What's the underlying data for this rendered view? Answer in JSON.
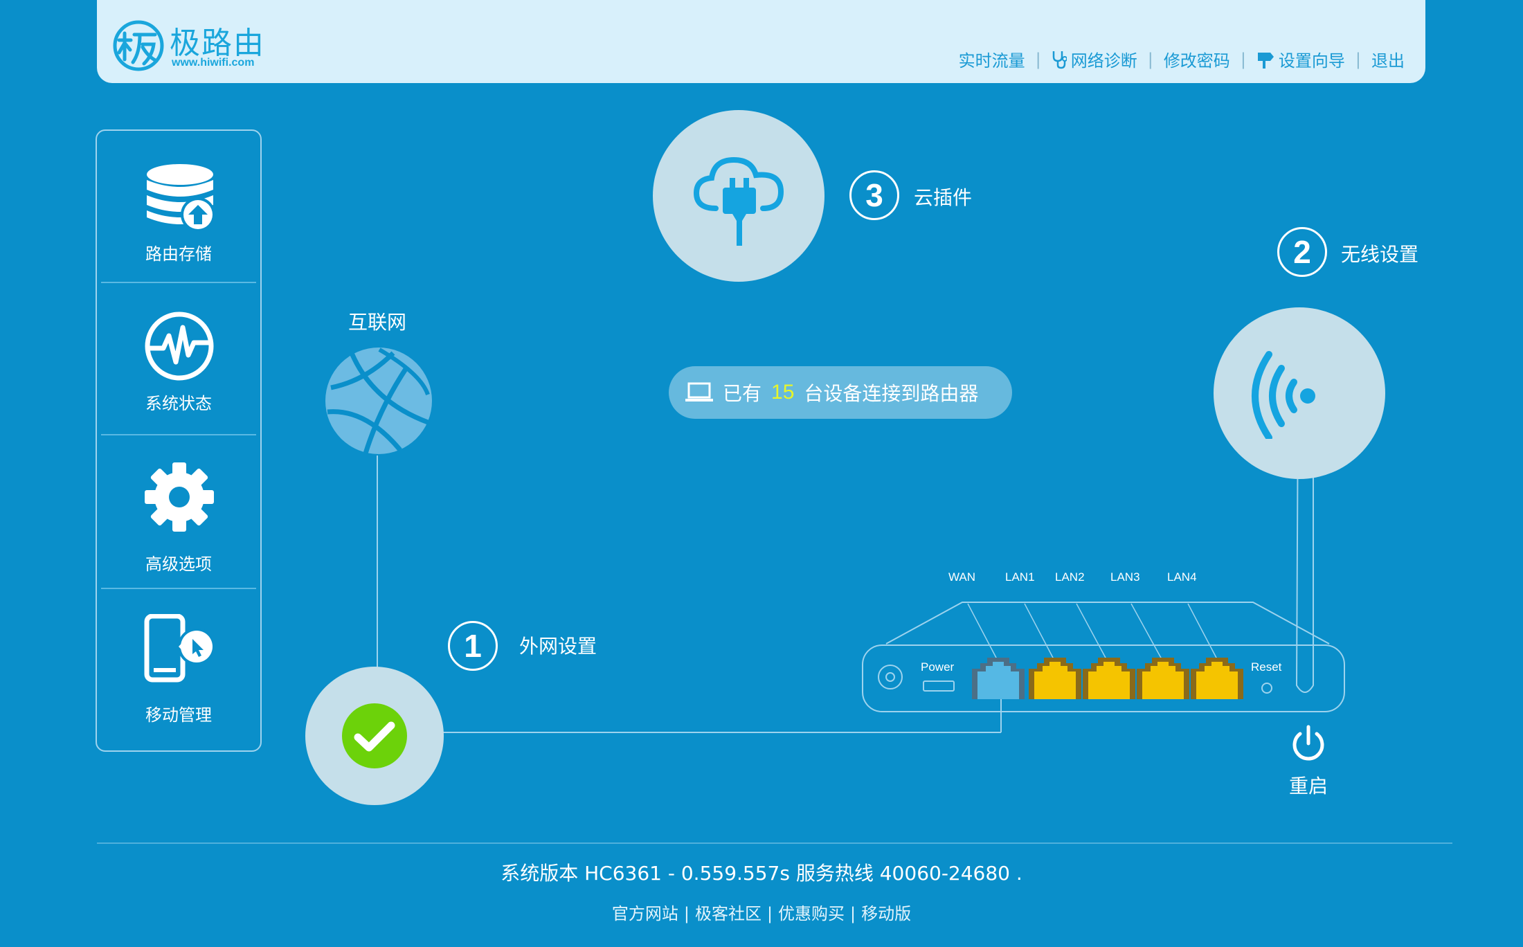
{
  "header": {
    "brand_name": "极路由",
    "brand_url": "www.hiwifi.com",
    "nav": {
      "realtime_traffic": "实时流量",
      "network_diagnosis": "网络诊断",
      "change_password": "修改密码",
      "setup_wizard": "设置向导",
      "logout": "退出"
    }
  },
  "sidebar": {
    "items": [
      {
        "label": "路由存储",
        "icon": "database-upload-icon"
      },
      {
        "label": "系统状态",
        "icon": "heartbeat-icon"
      },
      {
        "label": "高级选项",
        "icon": "gear-icon"
      },
      {
        "label": "移动管理",
        "icon": "mobile-cursor-icon"
      }
    ]
  },
  "main": {
    "internet_label": "互联网",
    "steps": [
      {
        "number": "1",
        "label": "外网设置"
      },
      {
        "number": "2",
        "label": "无线设置"
      },
      {
        "number": "3",
        "label": "云插件"
      }
    ],
    "devices": {
      "prefix": "已有",
      "count": "15",
      "suffix": "台设备连接到路由器"
    },
    "router": {
      "power_label": "Power",
      "reset_label": "Reset",
      "ports": [
        "WAN",
        "LAN1",
        "LAN2",
        "LAN3",
        "LAN4"
      ],
      "restart_label": "重启"
    },
    "wan_status": "connected"
  },
  "footer": {
    "version_text": "系统版本 HC6361 - 0.559.557s 服务热线 40060-24680 .",
    "links": [
      "官方网站",
      "极客社区",
      "优惠购买",
      "移动版"
    ]
  },
  "colors": {
    "background": "#0a8fca",
    "header_bg": "#d8f0fb",
    "accent": "#1aa6dc",
    "circle": "#c5dfea",
    "lan_port": "#f5c400",
    "wan_port": "#55b8e4",
    "success": "#6cd20a",
    "highlight_count": "#e7f52a"
  }
}
